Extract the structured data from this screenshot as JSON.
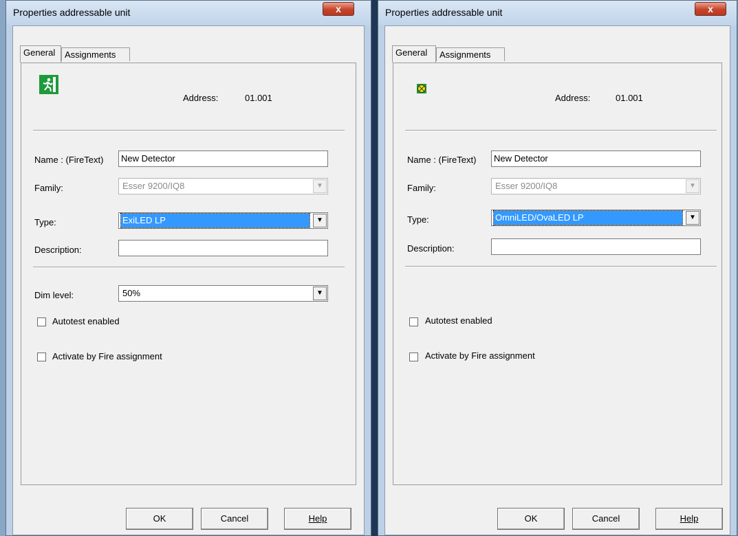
{
  "left_dialog": {
    "title": "Properties addressable unit",
    "close": "x",
    "tabs": [
      "General",
      "Assignments"
    ],
    "address_label": "Address:",
    "address_value": "01.001",
    "name_label": "Name : (FireText)",
    "name_value": "New Detector",
    "family_label": "Family:",
    "family_value": "Esser 9200/IQ8",
    "type_label": "Type:",
    "type_value": "ExiLED LP",
    "description_label": "Description:",
    "description_value": "",
    "dim_label": "Dim level:",
    "dim_value": "50%",
    "autotest_label": "Autotest enabled",
    "activate_label": "Activate by Fire assignment",
    "ok": "OK",
    "cancel": "Cancel",
    "help": "Help"
  },
  "right_dialog": {
    "title": "Properties addressable unit",
    "close": "x",
    "tabs": [
      "General",
      "Assignments"
    ],
    "address_label": "Address:",
    "address_value": "01.001",
    "name_label": "Name : (FireText)",
    "name_value": "New Detector",
    "family_label": "Family:",
    "family_value": "Esser 9200/IQ8",
    "type_label": "Type:",
    "type_value": "OmniLED/OvaLED LP",
    "description_label": "Description:",
    "description_value": "",
    "autotest_label": "Autotest enabled",
    "activate_label": "Activate by Fire assignment",
    "ok": "OK",
    "cancel": "Cancel",
    "help": "Help"
  },
  "colors": {
    "selection": "#3399ff",
    "icon_green": "#1d9a3b",
    "icon_yellow": "#f2e600",
    "close_red": "#c7432a"
  },
  "icons": {
    "left_device": "emergency-exit-icon",
    "right_device": "omniled-lamp-icon"
  }
}
